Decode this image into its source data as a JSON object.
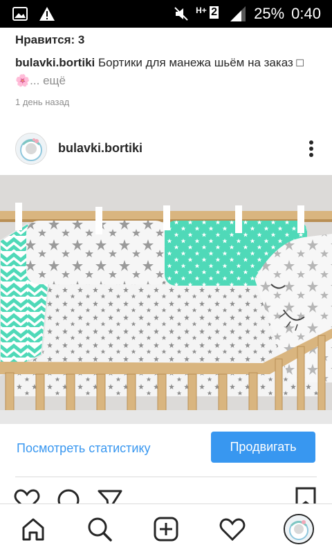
{
  "status_bar": {
    "battery_percent": "25%",
    "time": "0:40",
    "network_label": "H+",
    "sim_label": "2"
  },
  "previous_post": {
    "likes_text": "Нравится: 3",
    "caption_username": "bulavki.bortiki",
    "caption_text": " Бортики для манежа шьём на заказ □🌸",
    "caption_more": "... ещё",
    "time_ago": "1 день назад"
  },
  "post": {
    "username": "bulavki.bortiki",
    "stats_link": "Посмотреть статистику",
    "promote_label": "Продвигать"
  },
  "icons": {
    "status_left": [
      "image-icon",
      "warning-icon"
    ],
    "status_right": [
      "mute-icon",
      "signal-icon",
      "battery-icon"
    ],
    "actions": [
      "like-icon",
      "comment-icon",
      "share-icon",
      "save-icon"
    ],
    "nav": [
      "home-icon",
      "search-icon",
      "new-post-icon",
      "activity-icon",
      "profile-icon"
    ]
  },
  "colors": {
    "accent": "#3897f0",
    "mint": "#4fd9b8",
    "gray_star": "#9a9a9a",
    "wood": "#d9b57f"
  }
}
